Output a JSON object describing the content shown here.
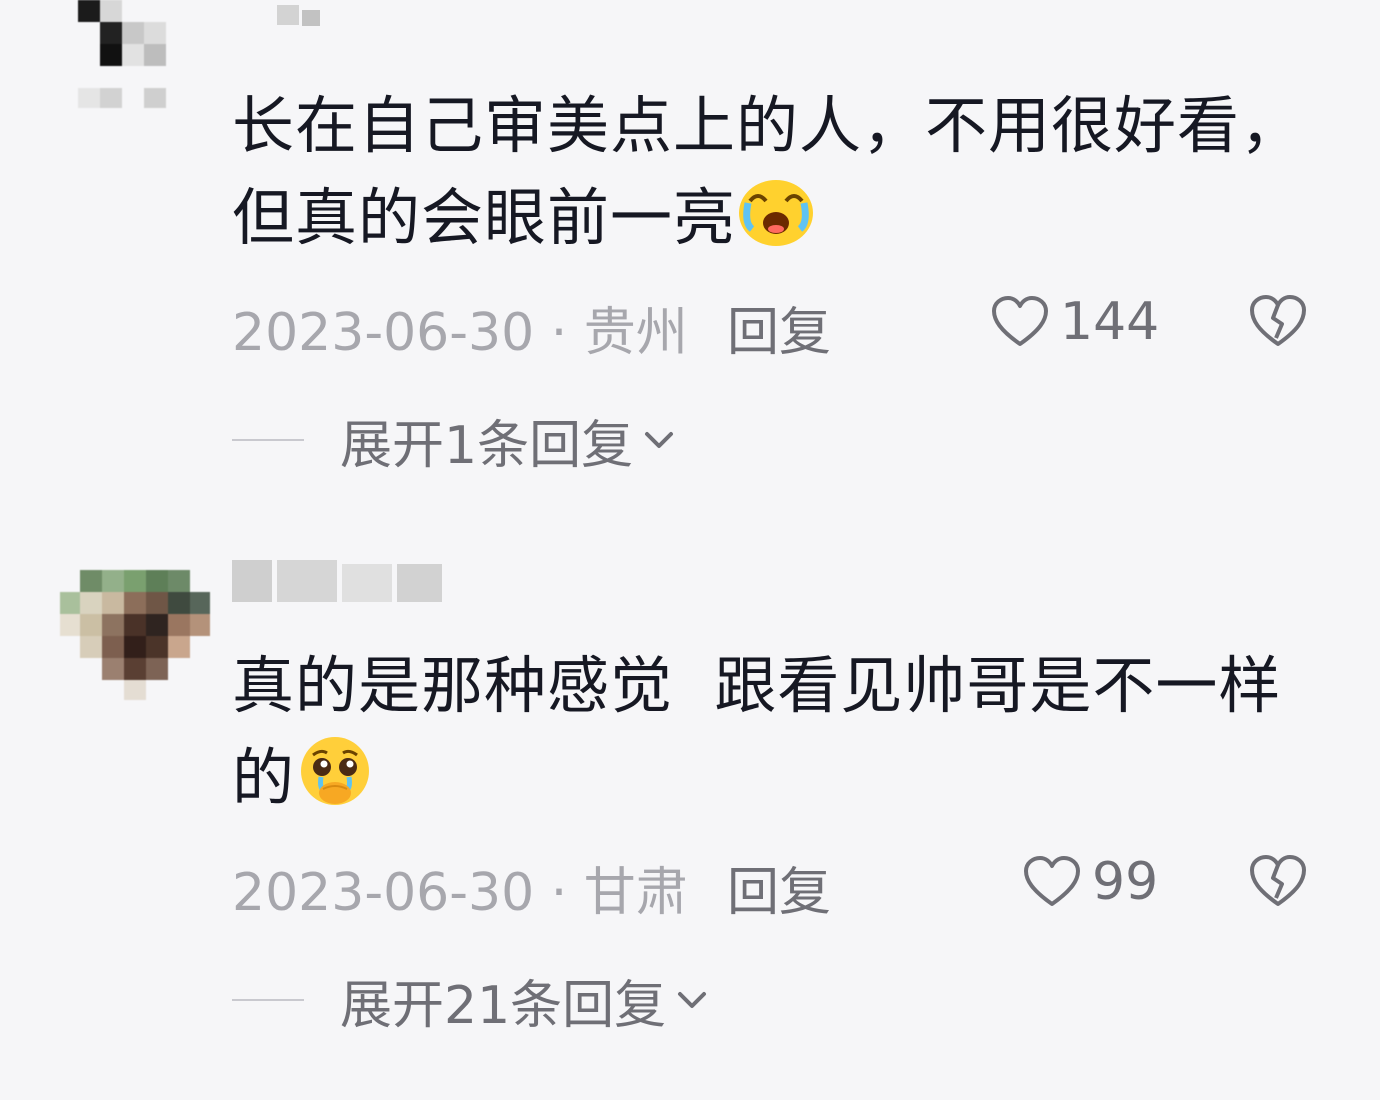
{
  "comments": [
    {
      "text": "长在自己审美点上的人，不用很好看，但真的会眼前一亮",
      "emoji": "laughing-crying-emoji",
      "date": "2023-06-30 · 贵州",
      "reply_label": "回复",
      "likes": "144",
      "expand_label": "展开1条回复"
    },
    {
      "text": "真的是那种感觉  跟看见帅哥是不一样的",
      "emoji": "pleading-covering-mouth-emoji",
      "date": "2023-06-30 · 甘肃",
      "reply_label": "回复",
      "likes": "99",
      "expand_label": "展开21条回复"
    }
  ],
  "icons": {
    "like": "heart-outline-icon",
    "dislike": "broken-heart-icon",
    "expand": "chevron-down-icon"
  },
  "colors": {
    "background": "#f6f6f8",
    "text": "#161823",
    "meta": "#a7a7ad",
    "action": "#6f6f76"
  }
}
